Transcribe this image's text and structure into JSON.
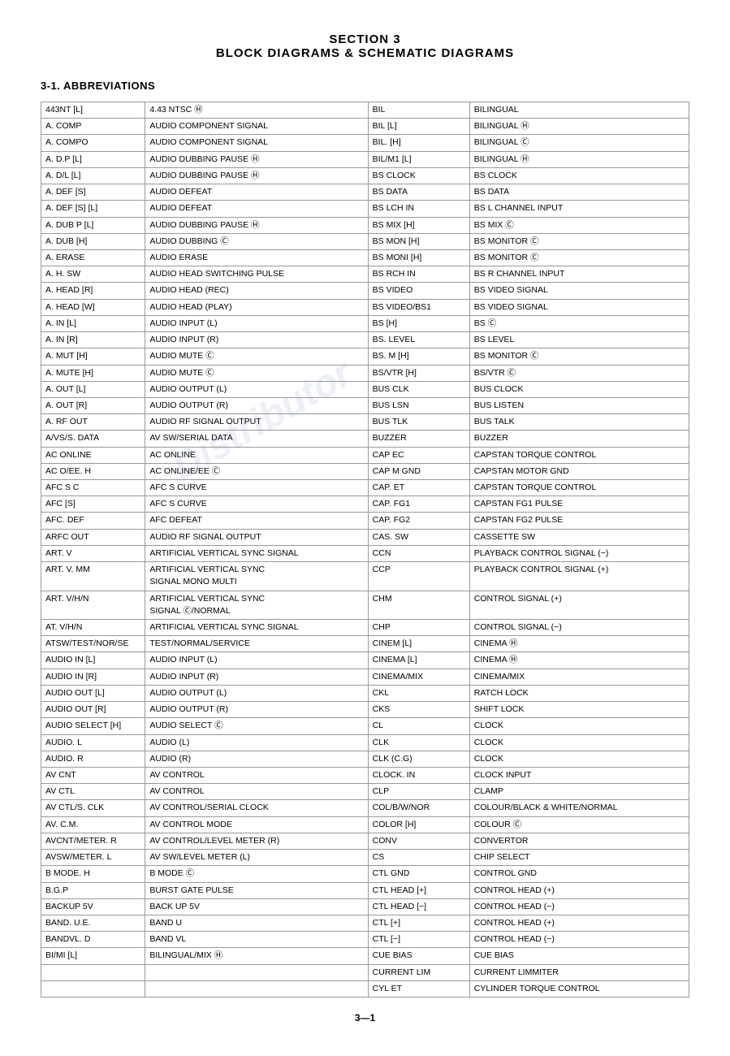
{
  "header": {
    "line1": "SECTION 3",
    "line2": "BLOCK DIAGRAMS & SCHEMATIC DIAGRAMS"
  },
  "section_label": "3-1.  ABBREVIATIONS",
  "watermark": "Distributor",
  "footer": "3—1",
  "left_pairs": [
    [
      "443NT [L]",
      "4.43 NTSC &#9405;"
    ],
    [
      "A. COMP",
      "AUDIO COMPONENT SIGNAL"
    ],
    [
      "A. COMPO",
      "AUDIO COMPONENT SIGNAL"
    ],
    [
      "A. D.P [L]",
      "AUDIO DUBBING PAUSE &#9405;"
    ],
    [
      "A. D/L [L]",
      "AUDIO DUBBING PAUSE &#9405;"
    ],
    [
      "A. DEF [S]",
      "AUDIO DEFEAT"
    ],
    [
      "A. DEF [S] [L]",
      "AUDIO DEFEAT"
    ],
    [
      "A. DUB P [L]",
      "AUDIO DUBBING PAUSE &#9405;"
    ],
    [
      "A. DUB [H]",
      "AUDIO DUBBING &#9400;"
    ],
    [
      "A. ERASE",
      "AUDIO ERASE"
    ],
    [
      "A. H. SW",
      "AUDIO HEAD SWITCHING PULSE"
    ],
    [
      "A. HEAD [R]",
      "AUDIO HEAD (REC)"
    ],
    [
      "A. HEAD [W]",
      "AUDIO HEAD (PLAY)"
    ],
    [
      "A. IN [L]",
      "AUDIO INPUT (L)"
    ],
    [
      "A. IN [R]",
      "AUDIO INPUT (R)"
    ],
    [
      "A. MUT [H]",
      "AUDIO MUTE &#9400;"
    ],
    [
      "A. MUTE [H]",
      "AUDIO MUTE &#9400;"
    ],
    [
      "A. OUT [L]",
      "AUDIO OUTPUT (L)"
    ],
    [
      "A. OUT [R]",
      "AUDIO OUTPUT (R)"
    ],
    [
      "A. RF OUT",
      "AUDIO RF SIGNAL OUTPUT"
    ],
    [
      "A/VS/S. DATA",
      "AV SW/SERIAL DATA"
    ],
    [
      "AC ONLINE",
      "AC ONLINE"
    ],
    [
      "AC O/EE. H",
      "AC ONLINE/EE &#9400;"
    ],
    [
      "AFC S C",
      "AFC S CURVE"
    ],
    [
      "AFC [S]",
      "AFC S CURVE"
    ],
    [
      "AFC. DEF",
      "AFC DEFEAT"
    ],
    [
      "ARFC OUT",
      "AUDIO RF SIGNAL OUTPUT"
    ],
    [
      "ART. V",
      "ARTIFICIAL VERTICAL SYNC SIGNAL"
    ],
    [
      "ART. V. MM",
      "ARTIFICIAL VERTICAL SYNC\nSIGNAL MONO MULTI"
    ],
    [
      "ART. V/H/N",
      "ARTIFICIAL VERTICAL SYNC\nSIGNAL &#9400;/NORMAL"
    ],
    [
      "AT. V/H/N",
      "ARTIFICIAL VERTICAL SYNC SIGNAL"
    ],
    [
      "ATSW/TEST/NOR/SE",
      "TEST/NORMAL/SERVICE"
    ],
    [
      "AUDIO IN [L]",
      "AUDIO INPUT (L)"
    ],
    [
      "AUDIO IN [R]",
      "AUDIO INPUT (R)"
    ],
    [
      "AUDIO OUT [L]",
      "AUDIO OUTPUT (L)"
    ],
    [
      "AUDIO OUT [R]",
      "AUDIO OUTPUT (R)"
    ],
    [
      "AUDIO SELECT [H]",
      "AUDIO SELECT &#9400;"
    ],
    [
      "AUDIO. L",
      "AUDIO (L)"
    ],
    [
      "AUDIO. R",
      "AUDIO (R)"
    ],
    [
      "AV CNT",
      "AV CONTROL"
    ],
    [
      "AV CTL",
      "AV CONTROL"
    ],
    [
      "AV CTL/S. CLK",
      "AV CONTROL/SERIAL CLOCK"
    ],
    [
      "AV. C.M.",
      "AV CONTROL MODE"
    ],
    [
      "AVCNT/METER. R",
      "AV CONTROL/LEVEL METER (R)"
    ],
    [
      "AVSW/METER. L",
      "AV SW/LEVEL METER (L)"
    ],
    [
      "B MODE. H",
      "B MODE &#9400;"
    ],
    [
      "B.G.P",
      "BURST GATE PULSE"
    ],
    [
      "BACKUP 5V",
      "BACK UP 5V"
    ],
    [
      "BAND. U.E.",
      "BAND U"
    ],
    [
      "BANDVL. D",
      "BAND VL"
    ],
    [
      "BI/MI [L]",
      "BILINGUAL/MIX &#9405;"
    ]
  ],
  "right_pairs": [
    [
      "BIL",
      "BILINGUAL"
    ],
    [
      "BIL [L]",
      "BILINGUAL &#9405;"
    ],
    [
      "BIL. [H]",
      "BILINGUAL &#9400;"
    ],
    [
      "BIL/M1 [L]",
      "BILINGUAL &#9405;"
    ],
    [
      "BS CLOCK",
      "BS CLOCK"
    ],
    [
      "BS DATA",
      "BS DATA"
    ],
    [
      "BS LCH IN",
      "BS L CHANNEL INPUT"
    ],
    [
      "BS MIX [H]",
      "BS MIX &#9400;"
    ],
    [
      "BS MON [H]",
      "BS MONITOR &#9400;"
    ],
    [
      "BS MONI [H]",
      "BS MONITOR &#9400;"
    ],
    [
      "BS RCH IN",
      "BS R CHANNEL INPUT"
    ],
    [
      "BS VIDEO",
      "BS VIDEO SIGNAL"
    ],
    [
      "BS VIDEO/BS1",
      "BS VIDEO SIGNAL"
    ],
    [
      "BS [H]",
      "BS &#9400;"
    ],
    [
      "BS. LEVEL",
      "BS LEVEL"
    ],
    [
      "BS. M [H]",
      "BS MONITOR &#9400;"
    ],
    [
      "BS/VTR [H]",
      "BS/VTR &#9400;"
    ],
    [
      "BUS CLK",
      "BUS CLOCK"
    ],
    [
      "BUS LSN",
      "BUS LISTEN"
    ],
    [
      "BUS TLK",
      "BUS TALK"
    ],
    [
      "BUZZER",
      "BUZZER"
    ],
    [
      "CAP EC",
      "CAPSTAN TORQUE CONTROL"
    ],
    [
      "CAP M GND",
      "CAPSTAN MOTOR GND"
    ],
    [
      "CAP. ET",
      "CAPSTAN TORQUE CONTROL"
    ],
    [
      "CAP. FG1",
      "CAPSTAN FG1 PULSE"
    ],
    [
      "CAP. FG2",
      "CAPSTAN FG2 PULSE"
    ],
    [
      "CAS. SW",
      "CASSETTE SW"
    ],
    [
      "CCN",
      "PLAYBACK CONTROL SIGNAL (&#8722;)"
    ],
    [
      "CCP",
      "PLAYBACK CONTROL SIGNAL (+)"
    ],
    [
      "CHM",
      "CONTROL SIGNAL (+)"
    ],
    [
      "CHP",
      "CONTROL SIGNAL (&#8722;)"
    ],
    [
      "CINEM [L]",
      "CINEMA &#9405;"
    ],
    [
      "CINEMA [L]",
      "CINEMA &#9405;"
    ],
    [
      "CINEMA/MIX",
      "CINEMA/MIX"
    ],
    [
      "CKL",
      "RATCH LOCK"
    ],
    [
      "CKS",
      "SHIFT LOCK"
    ],
    [
      "CL",
      "CLOCK"
    ],
    [
      "CLK",
      "CLOCK"
    ],
    [
      "CLK (C.G)",
      "CLOCK"
    ],
    [
      "CLOCK. IN",
      "CLOCK INPUT"
    ],
    [
      "CLP",
      "CLAMP"
    ],
    [
      "COL/B/W/NOR",
      "COLOUR/BLACK &amp; WHITE/NORMAL"
    ],
    [
      "COLOR [H]",
      "COLOUR &#9400;"
    ],
    [
      "CONV",
      "CONVERTOR"
    ],
    [
      "CS",
      "CHIP SELECT"
    ],
    [
      "CTL GND",
      "CONTROL GND"
    ],
    [
      "CTL HEAD [+]",
      "CONTROL HEAD (+)"
    ],
    [
      "CTL HEAD [&#8722;]",
      "CONTROL HEAD (&#8722;)"
    ],
    [
      "CTL [+]",
      "CONTROL HEAD (+)"
    ],
    [
      "CTL [&#8722;]",
      "CONTROL HEAD (&#8722;)"
    ],
    [
      "CUE BIAS",
      "CUE BIAS"
    ],
    [
      "CURRENT LIM",
      "CURRENT LIMMITER"
    ],
    [
      "CYL ET",
      "CYLINDER TORQUE CONTROL"
    ]
  ]
}
